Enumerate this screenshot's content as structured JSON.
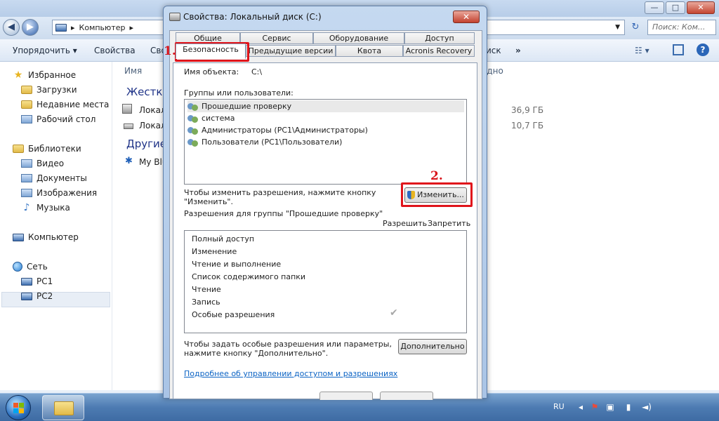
{
  "explorer": {
    "window_buttons": {
      "minimize": "—",
      "maximize": "□",
      "close": "✕"
    },
    "address": {
      "computer_icon": "computer-icon",
      "path": "Компьютер",
      "separator": "▸"
    },
    "search_placeholder": "Поиск: Ком...",
    "command_bar": {
      "organize": "Упорядочить ▾",
      "properties": "Свойства",
      "system_properties": "Сво",
      "more_right": "иск",
      "overflow": "»"
    },
    "sidebar": {
      "favorites": "Избранное",
      "downloads": "Загрузки",
      "recent": "Недавние места",
      "desktop": "Рабочий стол",
      "libraries": "Библиотеки",
      "video": "Видео",
      "documents": "Документы",
      "images": "Изображения",
      "music": "Музыка",
      "computer": "Компьютер",
      "network": "Сеть",
      "pc1": "PC1",
      "pc2": "PC2"
    },
    "content": {
      "col_name": "Имя",
      "col_free": "одно",
      "group_hdd": "Жестки",
      "drive_c": "Локал",
      "drive_d": "Локал",
      "drive_c_free": "36,9 ГБ",
      "drive_d_free": "10,7 ГБ",
      "group_other": "Другие",
      "bluetooth": "My Blu"
    }
  },
  "taskbar": {
    "language": "RU"
  },
  "dialog": {
    "title": "Свойства: Локальный диск (C:)",
    "close": "✕",
    "tabs_row1": [
      "Общие",
      "Сервис",
      "Оборудование",
      "Доступ"
    ],
    "tabs_row2": [
      "Безопасность",
      "Предыдущие версии",
      "Квота",
      "Acronis Recovery"
    ],
    "object_label": "Имя объекта:",
    "object_value": "C:\\",
    "groups_label": "Группы или пользователи:",
    "users": [
      "Прошедшие проверку",
      "система",
      "Администраторы (PC1\\Администраторы)",
      "Пользователи (PC1\\Пользователи)"
    ],
    "change_hint_1": "Чтобы изменить разрешения, нажмите кнопку",
    "change_hint_2": "\"Изменить\".",
    "change_button": "Изменить...",
    "permissions_for": "Разрешения для группы \"Прошедшие проверку\"",
    "allow": "Разрешить",
    "deny": "Запретить",
    "permissions": [
      "Полный доступ",
      "Изменение",
      "Чтение и выполнение",
      "Список содержимого папки",
      "Чтение",
      "Запись",
      "Особые разрешения"
    ],
    "special_hint_1": "Чтобы задать особые разрешения или параметры,",
    "special_hint_2": "нажмите кнопку \"Дополнительно\".",
    "advanced_button": "Дополнительно",
    "help_link": "Подробнее об управлении доступом и разрешениях"
  },
  "annotations": {
    "step1": "1.",
    "step2": "2.",
    "color": "#e0141b"
  }
}
